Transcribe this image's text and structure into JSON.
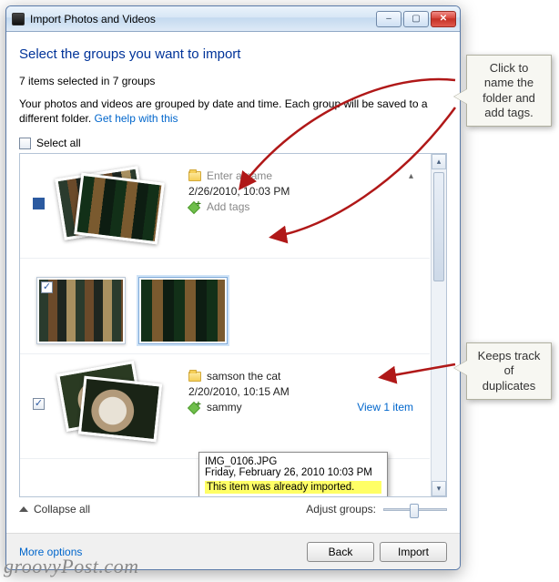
{
  "window": {
    "title": "Import Photos and Videos",
    "heading": "Select the groups you want to import",
    "status": "7 items selected in 7 groups",
    "description": "Your photos and videos are grouped by date and time. Each group will be saved to a different folder.",
    "help_link": "Get help with this",
    "select_all_label": "Select all",
    "collapse_label": "Collapse all",
    "adjust_label": "Adjust groups:",
    "more_options": "More options",
    "back_label": "Back",
    "import_label": "Import"
  },
  "groups": [
    {
      "name_placeholder": "Enter a name",
      "timestamp": "2/26/2010, 10:03 PM",
      "add_tags_label": "Add tags",
      "checked": true,
      "expanded_thumbs": [
        {
          "checked": true
        },
        {
          "checked": false,
          "highlighted": true
        }
      ]
    },
    {
      "name_value": "samson the cat",
      "timestamp": "2/20/2010, 10:15 AM",
      "tag_text": "sammy",
      "view_link": "View 1 item",
      "checked": true
    }
  ],
  "tooltip": {
    "filename": "IMG_0106.JPG",
    "date": "Friday, February 26, 2010 10:03 PM",
    "warning": "This item was already imported."
  },
  "callouts": {
    "naming": "Click to name the folder and add tags.",
    "duplicates": "Keeps track of duplicates"
  },
  "watermark": "groovyPost.com"
}
